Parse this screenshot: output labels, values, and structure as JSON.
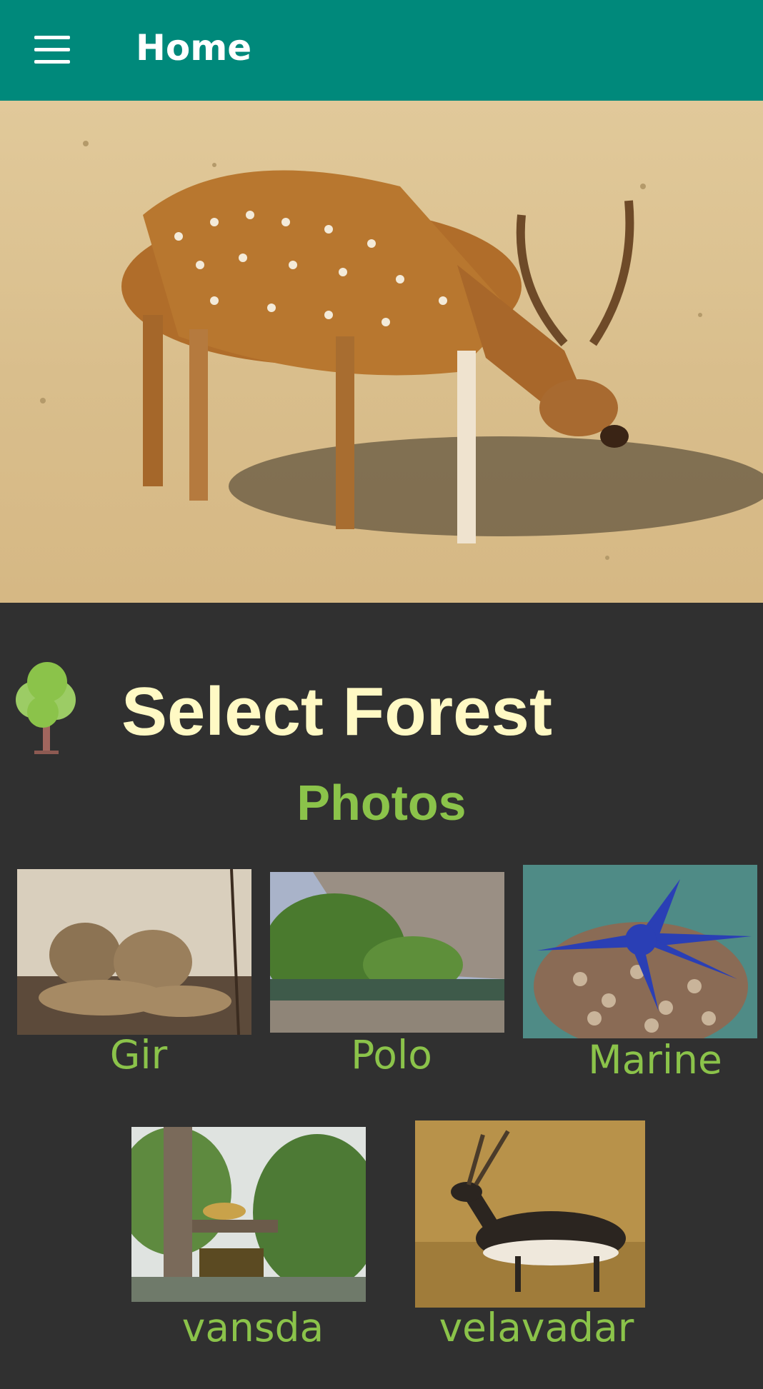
{
  "appbar": {
    "title": "Home",
    "menu_icon": "hamburger-menu-icon",
    "color": "#00897B"
  },
  "hero": {
    "image": "spotted-deer-photo"
  },
  "heading": {
    "title": "Select Forest",
    "icon": "tree-icon",
    "color": "#FFF9C4"
  },
  "subheading": {
    "label": "Photos",
    "color": "#8BC34A"
  },
  "forests": [
    {
      "label": "Gir",
      "image": "lions-photo"
    },
    {
      "label": "Polo",
      "image": "forest-river-photo"
    },
    {
      "label": "Marine",
      "image": "starfish-photo"
    },
    {
      "label": "vansda",
      "image": "vansda-national-park-photo"
    },
    {
      "label": "velavadar",
      "image": "blackbuck-photo"
    }
  ]
}
